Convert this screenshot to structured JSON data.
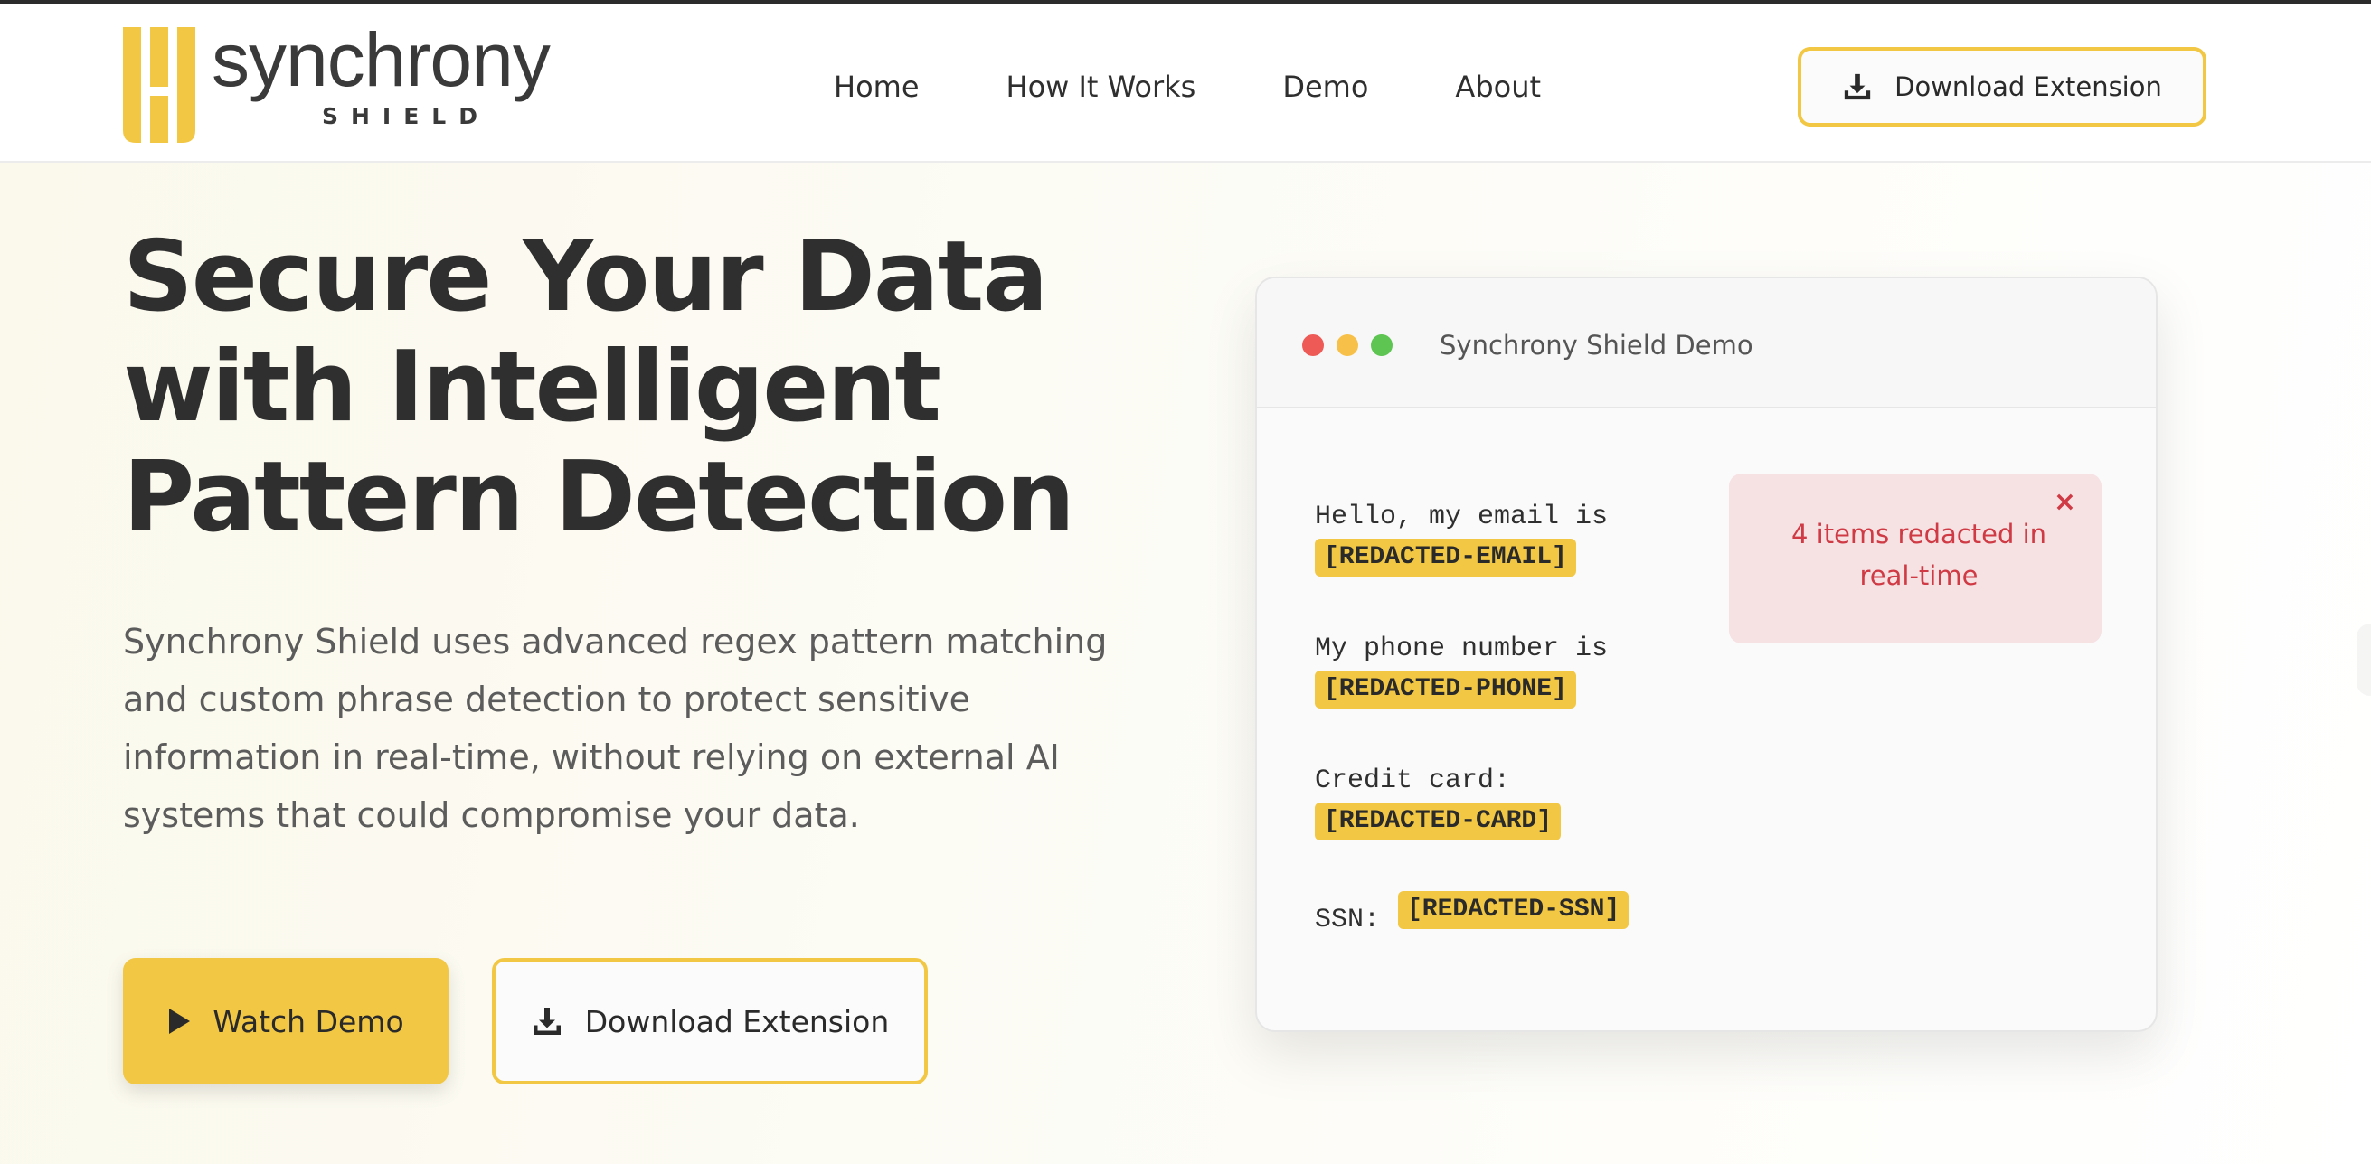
{
  "brand": {
    "name": "synchrony",
    "sub": "SHIELD",
    "colors": {
      "accent": "#f2c744",
      "text": "#2f2f2f",
      "alert": "#cf3a44",
      "alert_bg": "#f6e1e3"
    }
  },
  "nav": {
    "items": [
      {
        "label": "Home"
      },
      {
        "label": "How It Works"
      },
      {
        "label": "Demo"
      },
      {
        "label": "About"
      }
    ],
    "download": {
      "label": "Download Extension",
      "icon": "download-icon"
    }
  },
  "hero": {
    "title_lines": [
      "Secure Your Data",
      "with Intelligent",
      "Pattern Detection"
    ],
    "description": "Synchrony Shield uses advanced regex pattern matching and custom phrase detection to protect sensitive information in real-time, without relying on external AI systems that could compromise your data.",
    "primary_button": {
      "label": "Watch Demo",
      "icon": "play-icon"
    },
    "secondary_button": {
      "label": "Download Extension",
      "icon": "download-icon"
    }
  },
  "demo": {
    "title": "Synchrony Shield Demo",
    "lines": [
      {
        "text": "Hello, my email is",
        "tag": "[REDACTED-EMAIL]"
      },
      {
        "text": "My phone number is",
        "tag": "[REDACTED-PHONE]"
      },
      {
        "text": "Credit card:",
        "tag": "[REDACTED-CARD]"
      },
      {
        "text": "SSN:",
        "tag": "[REDACTED-SSN]"
      }
    ],
    "alert": {
      "text": "4 items redacted in real-time",
      "close": "×"
    }
  }
}
